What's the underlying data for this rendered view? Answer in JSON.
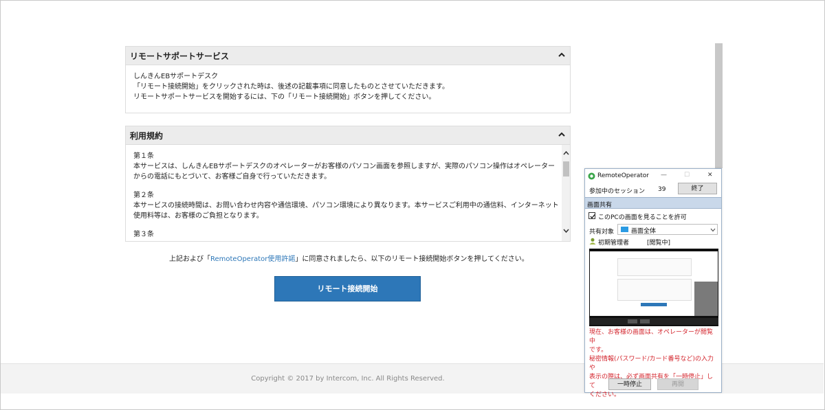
{
  "colors": {
    "accent": "#2d77b8",
    "warning": "#d3232b",
    "panel_header": "#ececec",
    "ro_section": "#c9d8ea"
  },
  "panels": {
    "remote_support": {
      "title": "リモートサポートサービス",
      "lines": [
        "しんきんEBサポートデスク",
        "「リモート接続開始」をクリックされた時は、後述の記載事項に同意したものとさせていただきます。",
        "リモートサポートサービスを開始するには、下の「リモート接続開始」ボタンを押してください。"
      ]
    },
    "terms": {
      "title": "利用規約",
      "sections": [
        {
          "heading": "第１条",
          "lines": [
            "本サービスは、しんきんEBサポートデスクのオペレーターがお客様のパソコン画面を参照しますが、実際のパソコン操作はオペレーター",
            "からの電話にもとづいて、お客様ご自身で行っていただきます。"
          ]
        },
        {
          "heading": "第２条",
          "lines": [
            "本サービスの接続時間は、お問い合わせ内容や通信環境、パソコン環境により異なります。本サービスご利用中の通信料、インターネット",
            "使用料等は、お客様のご負担となります。"
          ]
        },
        {
          "heading": "第３条",
          "lines": []
        }
      ]
    }
  },
  "agreement": {
    "prefix": "上記および「",
    "link": "RemoteOperator使用許諾",
    "suffix": "」に同意されましたら、以下のリモート接続開始ボタンを押してください。"
  },
  "start_button": "リモート接続開始",
  "footer": "Copyright © 2017 by Intercom, Inc. All Rights Reserved.",
  "remote_operator": {
    "title": "RemoteOperator",
    "window_controls": {
      "minimize": "—",
      "maximize": "☐",
      "close": "✕"
    },
    "session_label": "参加中のセッション",
    "session_count": "39",
    "end_button": "終了",
    "section_title": "画面共有",
    "allow_checkbox_label": "このPCの画面を見ることを許可",
    "allow_checked": true,
    "share_target_label": "共有対象",
    "share_target_value": "画面全体",
    "participant_name": "初期管理者",
    "participant_status": "[閲覧中]",
    "warning_lines": [
      "現在、お客様の画面は、オペレーターが閲覧中",
      "です。",
      "秘密情報(パスワード/カード番号など)の入力や",
      "表示の際は、必ず画面共有を「一時停止」して",
      "ください。"
    ],
    "pause_button": "一時停止",
    "resume_button": "再開",
    "preview_button": "リモート接続開始"
  }
}
